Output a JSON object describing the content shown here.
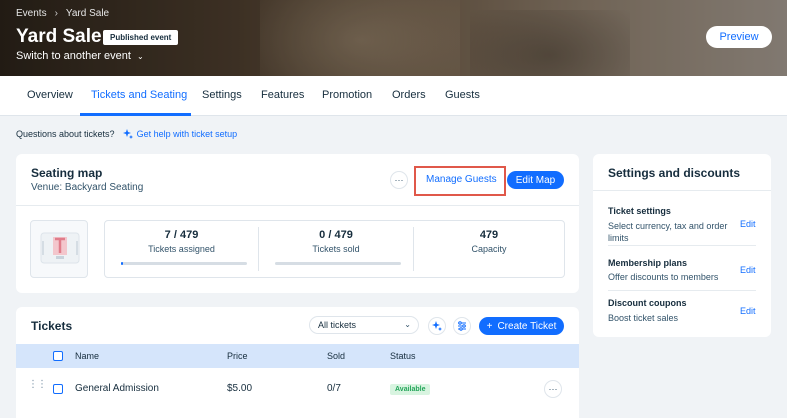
{
  "breadcrumb": {
    "root": "Events",
    "current": "Yard Sale"
  },
  "header": {
    "title": "Yard Sale",
    "status_badge": "Published event",
    "switch_label": "Switch to another event",
    "preview_label": "Preview"
  },
  "tabs": [
    {
      "label": "Overview"
    },
    {
      "label": "Tickets and Seating",
      "active": true
    },
    {
      "label": "Settings"
    },
    {
      "label": "Features"
    },
    {
      "label": "Promotion"
    },
    {
      "label": "Orders"
    },
    {
      "label": "Guests"
    }
  ],
  "help": {
    "question": "Questions about tickets?",
    "link": "Get help with ticket setup"
  },
  "seating": {
    "title": "Seating map",
    "venue": "Venue: Backyard Seating",
    "more_icon": "ellipsis-icon",
    "manage_guests": "Manage Guests",
    "edit_map": "Edit Map",
    "stats": [
      {
        "value": "7 / 479",
        "label": "Tickets assigned",
        "fraction": 0.015
      },
      {
        "value": "0 / 479",
        "label": "Tickets sold",
        "fraction": 0
      },
      {
        "value": "479",
        "label": "Capacity"
      }
    ]
  },
  "settings": {
    "title": "Settings and discounts",
    "items": [
      {
        "title": "Ticket settings",
        "desc": "Select currency, tax and order limits",
        "edit": "Edit"
      },
      {
        "title": "Membership plans",
        "desc": "Offer discounts to members",
        "edit": "Edit"
      },
      {
        "title": "Discount coupons",
        "desc": "Boost ticket sales",
        "edit": "Edit"
      }
    ]
  },
  "tickets": {
    "title": "Tickets",
    "filter": "All tickets",
    "create_label": "Create Ticket",
    "columns": {
      "name": "Name",
      "price": "Price",
      "sold": "Sold",
      "status": "Status"
    },
    "rows": [
      {
        "name": "General Admission",
        "price": "$5.00",
        "sold": "0/7",
        "status": "Available"
      }
    ]
  },
  "colors": {
    "accent": "#116dff",
    "highlight": "#e0584a",
    "available": "#25a55a"
  }
}
